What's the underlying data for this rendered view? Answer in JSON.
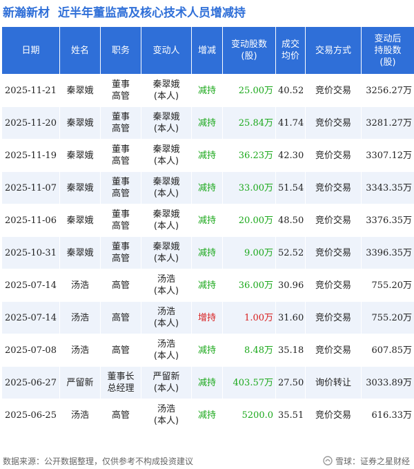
{
  "title": {
    "company": "新瀚新材",
    "text": "近半年董监高及核心技术人员增减持"
  },
  "table": {
    "headers": [
      "日期",
      "姓名",
      "职务",
      "变动人",
      "增减",
      "变动股数\n(股)",
      "成交\n均价",
      "交易方式",
      "变动后\n持股数\n(股)"
    ],
    "rows": [
      {
        "date": "2025-11-21",
        "name": "秦翠娥",
        "position": "董事\n高管",
        "changer": "秦翠娥\n(本人)",
        "direction": "减持",
        "shares": "25.00万",
        "price": "40.52",
        "method": "竞价交易",
        "after": "3256.27万"
      },
      {
        "date": "2025-11-20",
        "name": "秦翠娥",
        "position": "董事\n高管",
        "changer": "秦翠娥\n(本人)",
        "direction": "减持",
        "shares": "25.84万",
        "price": "41.74",
        "method": "竞价交易",
        "after": "3281.27万"
      },
      {
        "date": "2025-11-19",
        "name": "秦翠娥",
        "position": "董事\n高管",
        "changer": "秦翠娥\n(本人)",
        "direction": "减持",
        "shares": "36.23万",
        "price": "42.30",
        "method": "竞价交易",
        "after": "3307.12万"
      },
      {
        "date": "2025-11-07",
        "name": "秦翠娥",
        "position": "董事\n高管",
        "changer": "秦翠娥\n(本人)",
        "direction": "减持",
        "shares": "33.00万",
        "price": "51.54",
        "method": "竞价交易",
        "after": "3343.35万"
      },
      {
        "date": "2025-11-06",
        "name": "秦翠娥",
        "position": "董事\n高管",
        "changer": "秦翠娥\n(本人)",
        "direction": "减持",
        "shares": "20.00万",
        "price": "48.50",
        "method": "竞价交易",
        "after": "3376.35万"
      },
      {
        "date": "2025-10-31",
        "name": "秦翠娥",
        "position": "董事\n高管",
        "changer": "秦翠娥\n(本人)",
        "direction": "减持",
        "shares": "9.00万",
        "price": "52.52",
        "method": "竞价交易",
        "after": "3396.35万"
      },
      {
        "date": "2025-07-14",
        "name": "汤浩",
        "position": "高管",
        "changer": "汤浩\n(本人)",
        "direction": "减持",
        "shares": "36.00万",
        "price": "30.96",
        "method": "竞价交易",
        "after": "755.20万"
      },
      {
        "date": "2025-07-14",
        "name": "汤浩",
        "position": "高管",
        "changer": "汤浩\n(本人)",
        "direction": "增持",
        "shares": "1.00万",
        "price": "31.60",
        "method": "竞价交易",
        "after": "755.20万"
      },
      {
        "date": "2025-07-08",
        "name": "汤浩",
        "position": "高管",
        "changer": "汤浩\n(本人)",
        "direction": "减持",
        "shares": "8.48万",
        "price": "35.18",
        "method": "竞价交易",
        "after": "607.85万"
      },
      {
        "date": "2025-06-27",
        "name": "严留新",
        "position": "董事长\n总经理",
        "changer": "严留新\n(本人)",
        "direction": "减持",
        "shares": "403.57万",
        "price": "27.50",
        "method": "询价转让",
        "after": "3033.89万"
      },
      {
        "date": "2025-06-25",
        "name": "汤浩",
        "position": "高管",
        "changer": "汤浩\n(本人)",
        "direction": "减持",
        "shares": "5200.0",
        "price": "35.51",
        "method": "竞价交易",
        "after": "616.33万"
      }
    ]
  },
  "footer": {
    "source": "数据来源：公开数据整理，仅供参考不构成投资建议",
    "brand": "雪球：证券之星财经"
  },
  "colors": {
    "accent": "#2f6fd8",
    "reduce": "#1aa81a",
    "increase": "#d81e1e",
    "stripe": "#eef3fb"
  },
  "icons": {
    "brand": "snowball-icon"
  }
}
